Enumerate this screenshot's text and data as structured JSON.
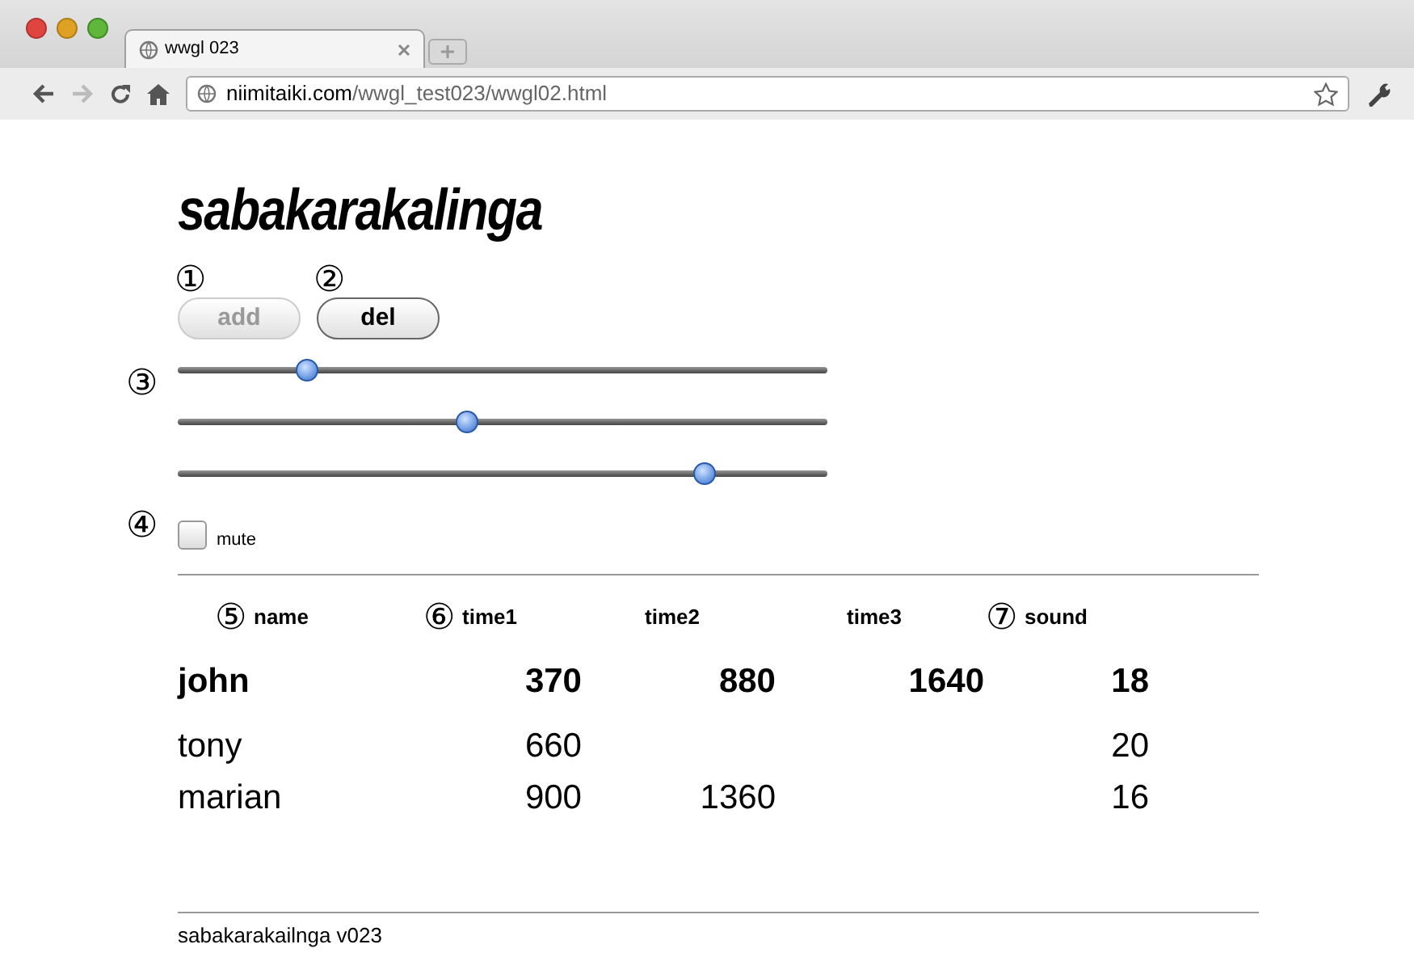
{
  "browser": {
    "tab": {
      "title": "wwgl 023",
      "selected": true
    },
    "address": {
      "host": "niimitaiki.com",
      "path": "/wwgl_test023/wwgl02.html"
    }
  },
  "page": {
    "title": "sabakarakalinga",
    "buttons": [
      {
        "marker": "①",
        "label": "add",
        "disabled": true
      },
      {
        "marker": "②",
        "label": "del",
        "disabled": false
      }
    ],
    "sliders": [
      {
        "marker": "③",
        "level": 0.2
      },
      {
        "level": 0.445
      },
      {
        "level": 0.81
      }
    ],
    "mute": {
      "marker": "④",
      "label": "mute",
      "checked": false
    },
    "table": {
      "columns": [
        {
          "marker": "⑤",
          "label": "name"
        },
        {
          "marker": "⑥",
          "label": "time1"
        },
        {
          "label": "time2"
        },
        {
          "label": "time3"
        },
        {
          "marker": "⑦",
          "label": "sound"
        }
      ],
      "rows": [
        {
          "bold": true,
          "cells": [
            "john",
            "370",
            "880",
            "1640",
            "18"
          ]
        },
        {
          "bold": false,
          "cells": [
            "tony",
            "660",
            "",
            "",
            "20"
          ]
        },
        {
          "bold": false,
          "cells": [
            "marian",
            "900",
            "1360",
            "",
            "16"
          ]
        }
      ]
    },
    "footer": "sabakarakailnga v023"
  }
}
